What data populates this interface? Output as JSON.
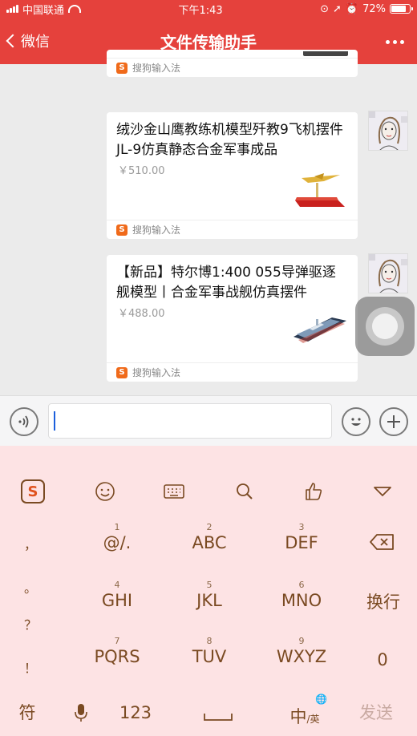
{
  "status": {
    "carrier": "中国联通",
    "time": "下午1:43",
    "battery": "72%"
  },
  "nav": {
    "back_label": "微信",
    "title": "文件传输助手"
  },
  "messages": [
    {
      "text": "",
      "price": "",
      "ime": "搜狗输入法"
    },
    {
      "text": "绒沙金山鹰教练机模型歼教9飞机摆件 JL-9仿真静态合金军事成品",
      "price": "￥510.00",
      "ime": "搜狗输入法"
    },
    {
      "text": "【新品】特尔博1:400 055导弹驱逐舰模型丨合金军事战舰仿真摆件",
      "price": "￥488.00",
      "ime": "搜狗输入法"
    }
  ],
  "input": {
    "value": ""
  },
  "keyboard": {
    "logo": "S",
    "punct": [
      "，",
      "。",
      "？",
      "！"
    ],
    "keys": [
      {
        "num": "1",
        "label": "@/."
      },
      {
        "num": "2",
        "label": "ABC"
      },
      {
        "num": "3",
        "label": "DEF"
      },
      {
        "num": "4",
        "label": "GHI"
      },
      {
        "num": "5",
        "label": "JKL"
      },
      {
        "num": "6",
        "label": "MNO"
      },
      {
        "num": "7",
        "label": "PQRS"
      },
      {
        "num": "8",
        "label": "TUV"
      },
      {
        "num": "9",
        "label": "WXYZ"
      }
    ],
    "enter": "换行",
    "zero": "0",
    "symbol": "符",
    "num_mode": "123",
    "lang_main": "中",
    "lang_sub": "/英",
    "send": "发送"
  },
  "colors": {
    "header": "#e5413c",
    "keyboard": "#fde3e4",
    "key_text": "#7a4a22"
  }
}
